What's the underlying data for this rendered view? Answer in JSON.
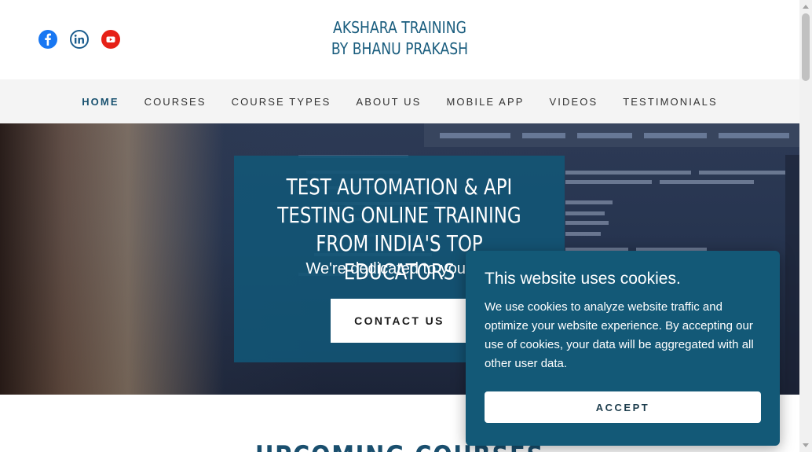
{
  "header": {
    "brand_line1": "AKSHARA TRAINING",
    "brand_line2": "BY BHANU PRAKASH",
    "social": [
      {
        "icon": "facebook-icon",
        "color": "#1877f2"
      },
      {
        "icon": "linkedin-icon",
        "color": "#1c5d8e"
      },
      {
        "icon": "youtube-icon",
        "color": "#e62117"
      }
    ]
  },
  "nav": {
    "items": [
      {
        "label": "HOME",
        "active": true
      },
      {
        "label": "COURSES"
      },
      {
        "label": "COURSE TYPES"
      },
      {
        "label": "ABOUT US"
      },
      {
        "label": "MOBILE APP"
      },
      {
        "label": "VIDEOS"
      },
      {
        "label": "TESTIMONIALS"
      }
    ]
  },
  "hero": {
    "title_line1": "TEST AUTOMATION & API",
    "title_line2": "TESTING ONLINE TRAINING",
    "title_line3": "FROM INDIA'S TOP EDUCATORS",
    "subtitle": "We're dedicated to your up",
    "cta_label": "CONTACT US"
  },
  "section": {
    "heading": "UPCOMING COURSES"
  },
  "cookie": {
    "title": "This website uses cookies.",
    "text": "We use cookies to analyze website traffic and optimize your website experience. By accepting our use of cookies, your data will be aggregated with all other user data.",
    "accept_label": "ACCEPT"
  },
  "colors": {
    "brand": "#1a5d7e",
    "overlay": "#115778",
    "cookie_bg": "#135977",
    "nav_bg": "#f4f4f4"
  }
}
